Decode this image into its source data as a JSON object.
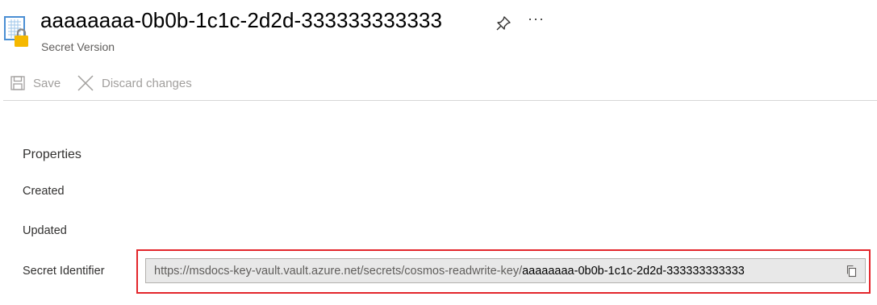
{
  "header": {
    "title": "aaaaaaaa-0b0b-1c1c-2d2d-333333333333",
    "subtitle": "Secret Version",
    "resource_icon": "key-vault-secret-icon",
    "pin_icon": "pin-icon",
    "more_label": "···"
  },
  "toolbar": {
    "save_label": "Save",
    "discard_label": "Discard changes"
  },
  "properties": {
    "section_title": "Properties",
    "created_label": "Created",
    "updated_label": "Updated",
    "secret_identifier_label": "Secret Identifier",
    "secret_identifier_prefix": "https://msdocs-key-vault.vault.azure.net/secrets/cosmos-readwrite-key/",
    "secret_identifier_version": "aaaaaaaa-0b0b-1c1c-2d2d-333333333333"
  },
  "colors": {
    "highlight_border": "#e3262b",
    "field_background": "#e8e8e8",
    "disabled_text": "#a19f9d",
    "icon_blue": "#4a8fd4",
    "lock_yellow": "#f5b800"
  }
}
